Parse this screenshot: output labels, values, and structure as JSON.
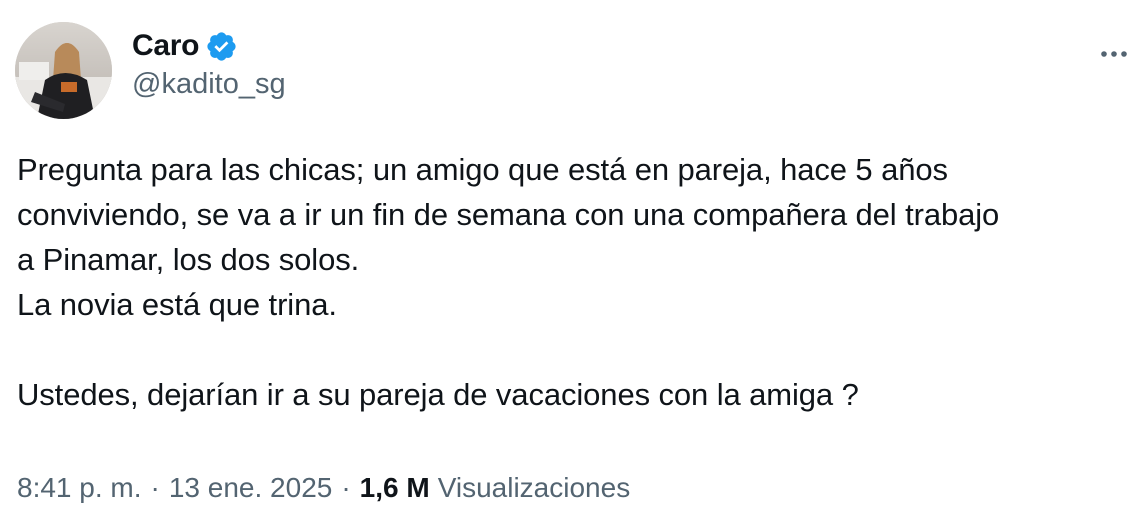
{
  "author": {
    "display_name": "Caro",
    "handle": "@kadito_sg",
    "verified": true,
    "verified_color": "#1d9bf0"
  },
  "tweet": {
    "lines": [
      "Pregunta para las chicas; un amigo que está en pareja, hace 5 años",
      "conviviendo, se va a ir un fin de semana con una compañera del trabajo",
      "a Pinamar, los dos solos.",
      "La novia está que trina.",
      "",
      "Ustedes, dejarían ir a su pareja de vacaciones con la amiga ?"
    ]
  },
  "meta": {
    "time": "8:41 p. m.",
    "separator": "·",
    "date": "13 ene. 2025",
    "views_count": "1,6 M",
    "views_label": "Visualizaciones"
  },
  "icons": {
    "more": "more-horizontal-icon",
    "verified": "verified-badge-icon"
  },
  "colors": {
    "text_primary": "#0f1419",
    "text_secondary": "#536471",
    "accent": "#1d9bf0"
  }
}
